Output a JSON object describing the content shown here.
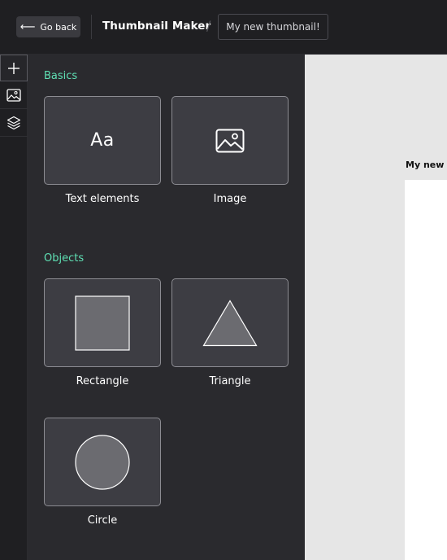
{
  "header": {
    "back_label": "Go back",
    "app_title": "Thumbnail Maker",
    "separator": "/",
    "project_name": "My new thumbnail!"
  },
  "rail": {
    "items": [
      {
        "icon": "plus-icon",
        "active": true
      },
      {
        "icon": "image-icon",
        "active": false
      },
      {
        "icon": "layers-icon",
        "active": false
      }
    ]
  },
  "panel": {
    "basics": {
      "title": "Basics",
      "items": [
        {
          "label": "Text elements",
          "icon": "text-aa-icon",
          "glyph": "Aa"
        },
        {
          "label": "Image",
          "icon": "image-icon"
        }
      ]
    },
    "objects": {
      "title": "Objects",
      "items": [
        {
          "label": "Rectangle",
          "icon": "rectangle-icon"
        },
        {
          "label": "Triangle",
          "icon": "triangle-icon"
        },
        {
          "label": "Circle",
          "icon": "circle-icon"
        }
      ]
    }
  },
  "canvas": {
    "label": "My new thumbnail!"
  },
  "colors": {
    "accent": "#5fe0b4",
    "panel_bg": "#2a2a2e",
    "tile_bg": "#3d3d43",
    "shape_fill": "#6b6b70"
  }
}
